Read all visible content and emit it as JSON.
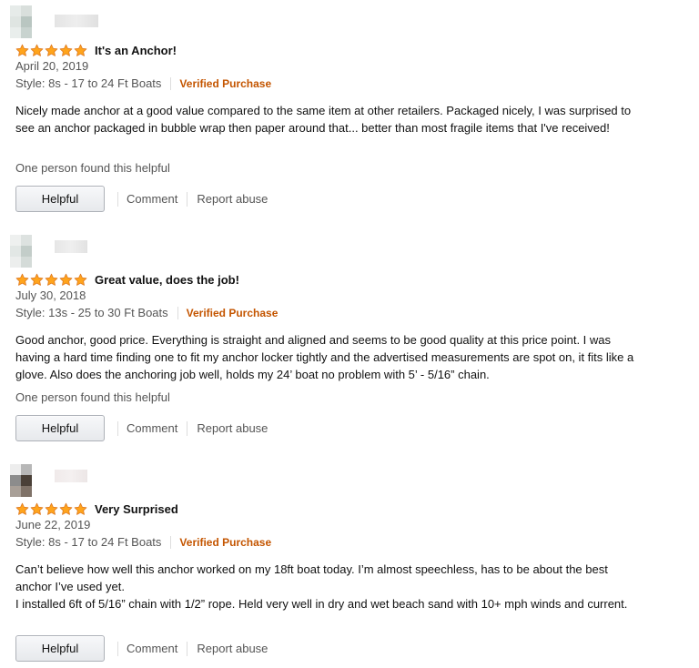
{
  "colors": {
    "star": "#ffa41c",
    "verified": "#c45500",
    "muted": "#555555"
  },
  "reviews": [
    {
      "title": "It's an Anchor!",
      "rating": 5,
      "date": "April 20, 2019",
      "style": "Style: 8s - 17 to 24 Ft Boats",
      "verified": "Verified Purchase",
      "body": "Nicely made anchor at a good value compared to the same item at other retailers. Packaged nicely, I was surprised to see an anchor packaged in bubble wrap then paper around that... better than most fragile items that I've received!",
      "helpful_count": "One person found this helpful",
      "helpful_label": "Helpful",
      "comment_label": "Comment",
      "report_label": "Report abuse"
    },
    {
      "title": "Great value, does the job!",
      "rating": 5,
      "date": "July 30, 2018",
      "style": "Style: 13s - 25 to 30 Ft Boats",
      "verified": "Verified Purchase",
      "body": "Good anchor, good price. Everything is straight and aligned and seems to be good quality at this price point. I was having a hard time finding one to fit my anchor locker tightly and the advertised measurements are spot on, it fits like a glove. Also does the anchoring job well, holds my 24’ boat no problem with 5’ - 5/16” chain.",
      "helpful_count": "One person found this helpful",
      "helpful_label": "Helpful",
      "comment_label": "Comment",
      "report_label": "Report abuse"
    },
    {
      "title": "Very Surprised",
      "rating": 5,
      "date": "June 22, 2019",
      "style": "Style: 8s - 17 to 24 Ft Boats",
      "verified": "Verified Purchase",
      "body_lines": [
        "Can’t believe how well this anchor worked on my 18ft boat today. I’m almost speechless, has to be about the best anchor I’ve used yet.",
        "I installed 6ft of 5/16” chain with 1/2” rope. Held very well in dry and wet beach sand with 10+ mph winds and current."
      ],
      "helpful_label": "Helpful",
      "comment_label": "Comment",
      "report_label": "Report abuse"
    }
  ]
}
